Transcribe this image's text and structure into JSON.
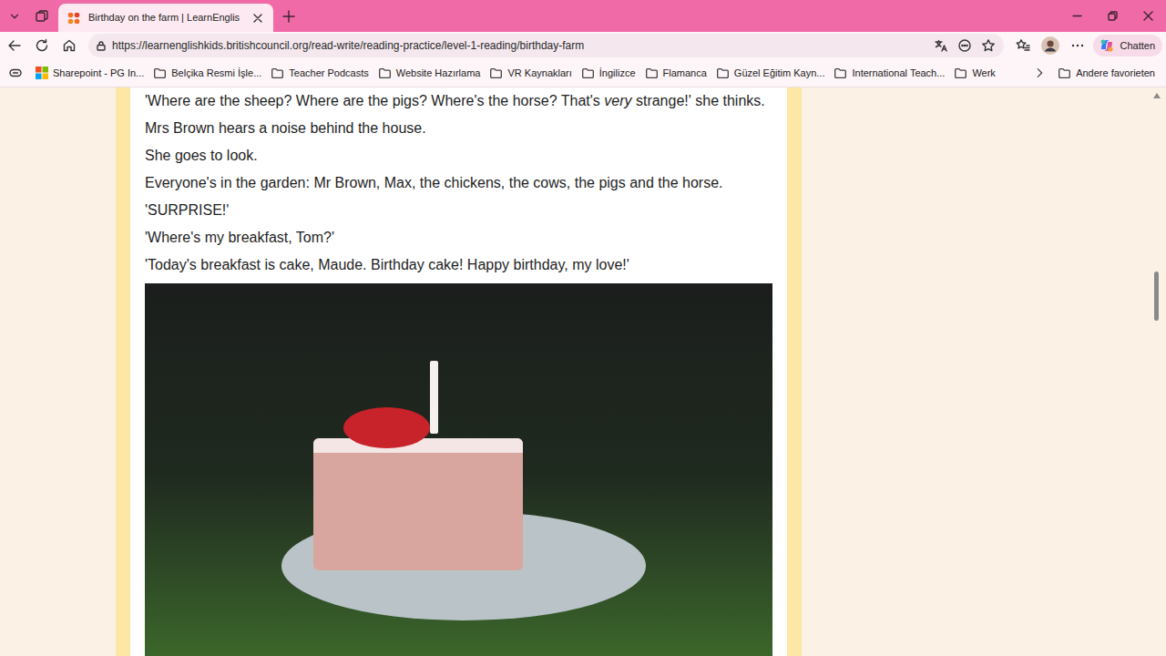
{
  "window": {
    "tabs": [
      {
        "label": "Birthday on the farm | LearnEnglis",
        "selected": true
      }
    ]
  },
  "toolbar": {
    "url": "https://learnenglishkids.britishcouncil.org/read-write/reading-practice/level-1-reading/birthday-farm",
    "copilot_label": "Chatten"
  },
  "bookmarks": {
    "items": [
      {
        "label": "Sharepoint - PG In...",
        "kind": "site"
      },
      {
        "label": "Belçika Resmi İşle...",
        "kind": "folder"
      },
      {
        "label": "Teacher Podcasts",
        "kind": "folder"
      },
      {
        "label": "Website Hazırlama",
        "kind": "folder"
      },
      {
        "label": "VR Kaynakları",
        "kind": "folder"
      },
      {
        "label": "İngilizce",
        "kind": "folder"
      },
      {
        "label": "Flamanca",
        "kind": "folder"
      },
      {
        "label": "Güzel Eğitim Kayn...",
        "kind": "folder"
      },
      {
        "label": "International Teach...",
        "kind": "folder"
      },
      {
        "label": "Werk",
        "kind": "folder"
      }
    ],
    "other": {
      "label": "Andere favorieten"
    }
  },
  "story": {
    "lines": [
      {
        "segments": [
          {
            "text": "'Where are the sheep? Where are the pigs? Where's the horse? That's ",
            "italic": false
          },
          {
            "text": "very",
            "italic": true
          },
          {
            "text": " strange!' she thinks.",
            "italic": false
          }
        ]
      },
      {
        "segments": [
          {
            "text": "Mrs Brown hears a noise behind the house.",
            "italic": false
          }
        ]
      },
      {
        "segments": [
          {
            "text": "She goes to look.",
            "italic": false
          }
        ]
      },
      {
        "segments": [
          {
            "text": "Everyone's in the garden: Mr Brown, Max, the chickens, the cows, the pigs and the horse.",
            "italic": false
          }
        ]
      },
      {
        "segments": [
          {
            "text": "'SURPRISE!'",
            "italic": false
          }
        ]
      },
      {
        "segments": [
          {
            "text": "'Where's my breakfast, Tom?'",
            "italic": false
          }
        ]
      },
      {
        "segments": [
          {
            "text": "'Today's breakfast is cake, Maude. Birthday cake! Happy birthday, my love!'",
            "italic": false
          }
        ]
      }
    ]
  }
}
